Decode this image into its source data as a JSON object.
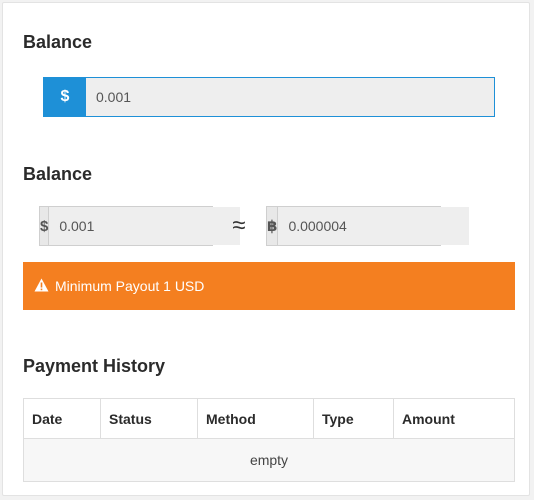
{
  "balance_section": {
    "title": "Balance",
    "currency_symbol": "$",
    "value": "0.001"
  },
  "conversion_section": {
    "title": "Balance",
    "usd_symbol": "$",
    "usd_value": "0.001",
    "approx_symbol": "≈",
    "btc_symbol": "฿",
    "btc_value": "0.000004"
  },
  "alert": {
    "icon": "warning-icon",
    "text": "Minimum Payout 1 USD",
    "color": "#f47f20"
  },
  "payment_history": {
    "title": "Payment History",
    "columns": [
      "Date",
      "Status",
      "Method",
      "Type",
      "Amount"
    ],
    "empty_text": "empty"
  },
  "colors": {
    "accent": "#1e90d7",
    "warning": "#f47f20"
  }
}
